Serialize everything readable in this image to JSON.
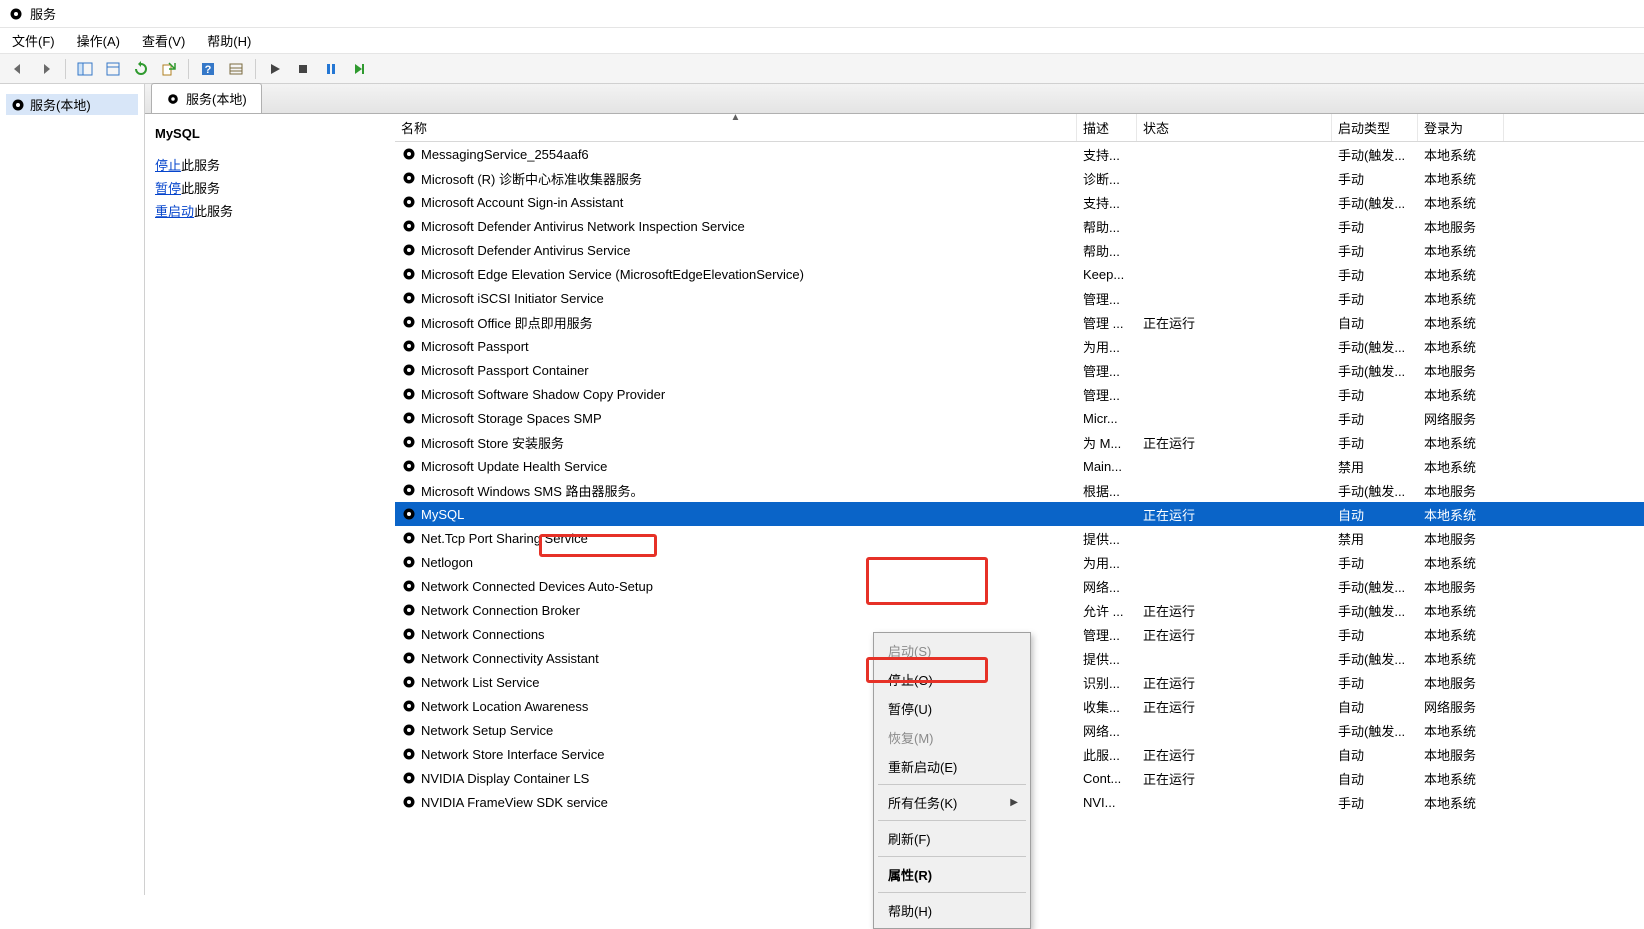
{
  "window": {
    "title": "服务"
  },
  "menubar": {
    "file": "文件(F)",
    "action": "操作(A)",
    "view": "查看(V)",
    "help": "帮助(H)"
  },
  "tree": {
    "root": "服务(本地)"
  },
  "tab": {
    "label": "服务(本地)"
  },
  "detail": {
    "selected_name": "MySQL",
    "stop_link": "停止",
    "stop_rest": "此服务",
    "pause_link": "暂停",
    "pause_rest": "此服务",
    "restart_link": "重启动",
    "restart_rest": "此服务"
  },
  "columns": {
    "name": "名称",
    "desc": "描述",
    "status": "状态",
    "startup": "启动类型",
    "logon": "登录为"
  },
  "services": [
    {
      "name": "MessagingService_2554aaf6",
      "desc": "支持...",
      "status": "",
      "startup": "手动(触发...",
      "logon": "本地系统"
    },
    {
      "name": "Microsoft (R) 诊断中心标准收集器服务",
      "desc": "诊断...",
      "status": "",
      "startup": "手动",
      "logon": "本地系统"
    },
    {
      "name": "Microsoft Account Sign-in Assistant",
      "desc": "支持...",
      "status": "",
      "startup": "手动(触发...",
      "logon": "本地系统"
    },
    {
      "name": "Microsoft Defender Antivirus Network Inspection Service",
      "desc": "帮助...",
      "status": "",
      "startup": "手动",
      "logon": "本地服务"
    },
    {
      "name": "Microsoft Defender Antivirus Service",
      "desc": "帮助...",
      "status": "",
      "startup": "手动",
      "logon": "本地系统"
    },
    {
      "name": "Microsoft Edge Elevation Service (MicrosoftEdgeElevationService)",
      "desc": "Keep...",
      "status": "",
      "startup": "手动",
      "logon": "本地系统"
    },
    {
      "name": "Microsoft iSCSI Initiator Service",
      "desc": "管理...",
      "status": "",
      "startup": "手动",
      "logon": "本地系统"
    },
    {
      "name": "Microsoft Office 即点即用服务",
      "desc": "管理 ...",
      "status": "正在运行",
      "startup": "自动",
      "logon": "本地系统"
    },
    {
      "name": "Microsoft Passport",
      "desc": "为用...",
      "status": "",
      "startup": "手动(触发...",
      "logon": "本地系统"
    },
    {
      "name": "Microsoft Passport Container",
      "desc": "管理...",
      "status": "",
      "startup": "手动(触发...",
      "logon": "本地服务"
    },
    {
      "name": "Microsoft Software Shadow Copy Provider",
      "desc": "管理...",
      "status": "",
      "startup": "手动",
      "logon": "本地系统"
    },
    {
      "name": "Microsoft Storage Spaces SMP",
      "desc": "Micr...",
      "status": "",
      "startup": "手动",
      "logon": "网络服务"
    },
    {
      "name": "Microsoft Store 安装服务",
      "desc": "为 M...",
      "status": "正在运行",
      "startup": "手动",
      "logon": "本地系统"
    },
    {
      "name": "Microsoft Update Health Service",
      "desc": "Main...",
      "status": "",
      "startup": "禁用",
      "logon": "本地系统"
    },
    {
      "name": "Microsoft Windows SMS 路由器服务。",
      "desc": "根据...",
      "status": "",
      "startup": "手动(触发...",
      "logon": "本地服务"
    },
    {
      "name": "MySQL",
      "desc": "",
      "status": "正在运行",
      "startup": "自动",
      "logon": "本地系统",
      "selected": true
    },
    {
      "name": "Net.Tcp Port Sharing Service",
      "desc": "提供...",
      "status": "",
      "startup": "禁用",
      "logon": "本地服务"
    },
    {
      "name": "Netlogon",
      "desc": "为用...",
      "status": "",
      "startup": "手动",
      "logon": "本地系统"
    },
    {
      "name": "Network Connected Devices Auto-Setup",
      "desc": "网络...",
      "status": "",
      "startup": "手动(触发...",
      "logon": "本地服务"
    },
    {
      "name": "Network Connection Broker",
      "desc": "允许 ...",
      "status": "正在运行",
      "startup": "手动(触发...",
      "logon": "本地系统"
    },
    {
      "name": "Network Connections",
      "desc": "管理...",
      "status": "正在运行",
      "startup": "手动",
      "logon": "本地系统"
    },
    {
      "name": "Network Connectivity Assistant",
      "desc": "提供...",
      "status": "",
      "startup": "手动(触发...",
      "logon": "本地系统"
    },
    {
      "name": "Network List Service",
      "desc": "识别...",
      "status": "正在运行",
      "startup": "手动",
      "logon": "本地服务"
    },
    {
      "name": "Network Location Awareness",
      "desc": "收集...",
      "status": "正在运行",
      "startup": "自动",
      "logon": "网络服务"
    },
    {
      "name": "Network Setup Service",
      "desc": "网络...",
      "status": "",
      "startup": "手动(触发...",
      "logon": "本地系统"
    },
    {
      "name": "Network Store Interface Service",
      "desc": "此服...",
      "status": "正在运行",
      "startup": "自动",
      "logon": "本地服务"
    },
    {
      "name": "NVIDIA Display Container LS",
      "desc": "Cont...",
      "status": "正在运行",
      "startup": "自动",
      "logon": "本地系统"
    },
    {
      "name": "NVIDIA FrameView SDK service",
      "desc": "NVI...",
      "status": "",
      "startup": "手动",
      "logon": "本地系统"
    }
  ],
  "context_menu": {
    "start": "启动(S)",
    "stop": "停止(O)",
    "pause": "暂停(U)",
    "resume": "恢复(M)",
    "restart": "重新启动(E)",
    "all_tasks": "所有任务(K)",
    "refresh": "刷新(F)",
    "properties": "属性(R)",
    "help": "帮助(H)"
  }
}
